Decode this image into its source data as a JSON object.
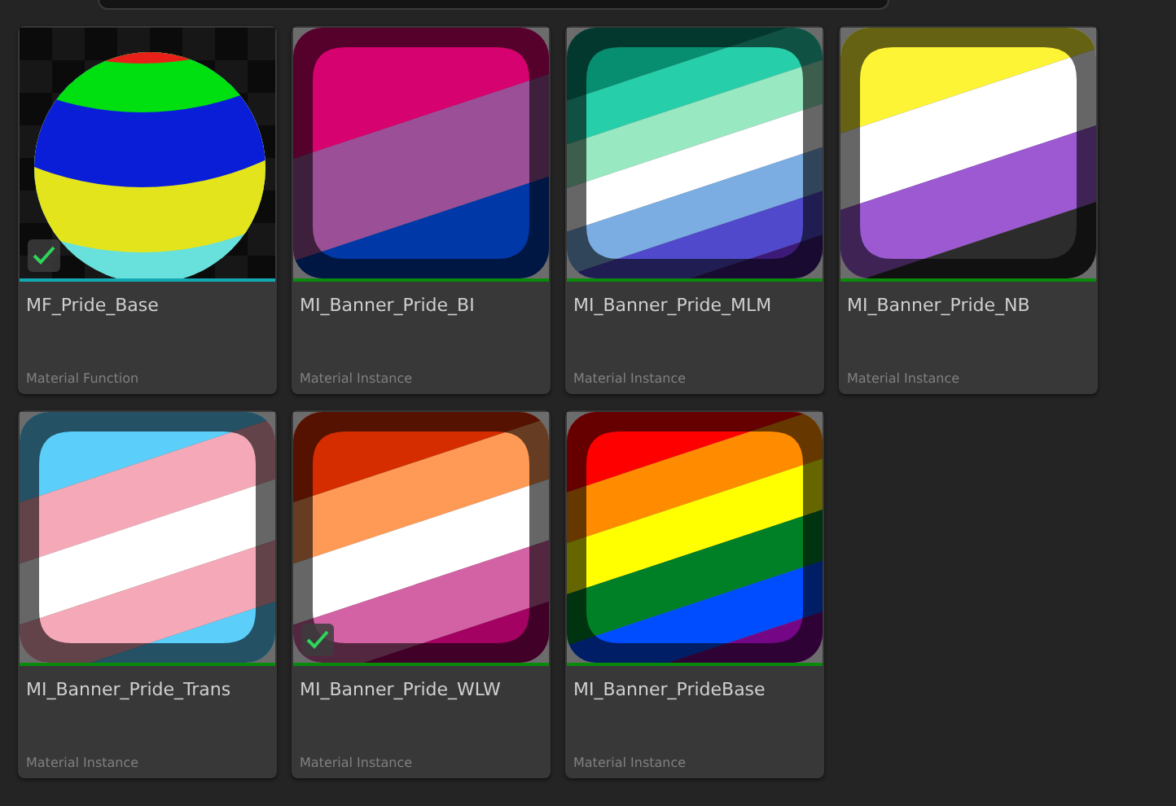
{
  "assets": [
    {
      "name": "MF_Pride_Base",
      "type": "Material Function",
      "kind": "function",
      "checked": true
    },
    {
      "name": "MI_Banner_Pride_BI",
      "type": "Material Instance",
      "kind": "instance",
      "checked": false
    },
    {
      "name": "MI_Banner_Pride_MLM",
      "type": "Material Instance",
      "kind": "instance",
      "checked": false
    },
    {
      "name": "MI_Banner_Pride_NB",
      "type": "Material Instance",
      "kind": "instance",
      "checked": false
    },
    {
      "name": "MI_Banner_Pride_Trans",
      "type": "Material Instance",
      "kind": "instance",
      "checked": false
    },
    {
      "name": "MI_Banner_Pride_WLW",
      "type": "Material Instance",
      "kind": "instance",
      "checked": true
    },
    {
      "name": "MI_Banner_PrideBase",
      "type": "Material Instance",
      "kind": "instance",
      "checked": false
    }
  ]
}
